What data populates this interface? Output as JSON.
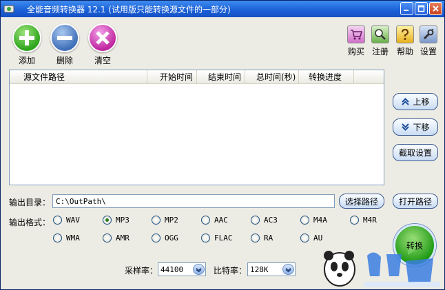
{
  "window": {
    "title": "全能音频转换器 12.1 (试用版只能转换源文件的一部分)"
  },
  "toolbar": {
    "add_label": "添加",
    "remove_label": "删除",
    "clear_label": "清空",
    "buy_label": "购买",
    "register_label": "注册",
    "help_label": "帮助",
    "settings_label": "设置"
  },
  "list": {
    "columns": [
      "源文件路径",
      "开始时间",
      "结束时间",
      "总时间(秒)",
      "转换进度"
    ]
  },
  "side": {
    "up_label": "上移",
    "down_label": "下移",
    "clip_label": "截取设置",
    "open_path_label": "打开路径",
    "convert_label": "转换"
  },
  "output": {
    "dir_label": "输出目录：",
    "dir_value": "C:\\OutPath\\",
    "choose_path_label": "选择路径",
    "format_label": "输出格式：",
    "formats": [
      "WAV",
      "MP3",
      "MP2",
      "AAC",
      "AC3",
      "M4A",
      "M4R",
      "WMA",
      "AMR",
      "OGG",
      "FLAC",
      "RA",
      "AU"
    ],
    "selected_format": "MP3"
  },
  "params": {
    "sample_rate_label": "采样率：",
    "sample_rate_value": "44100",
    "bitrate_label": "比特率：",
    "bitrate_value": "128K"
  },
  "colors": {
    "title_bar": "#1a5fd6",
    "window_bg": "#ecebe4",
    "button_border": "#3a5a90"
  }
}
